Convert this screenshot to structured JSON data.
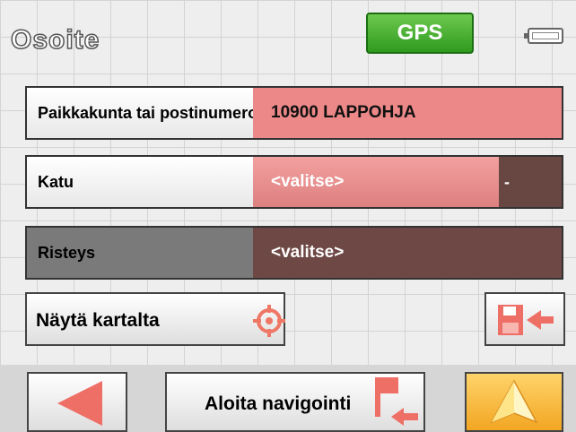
{
  "header": {
    "title": "Osoite",
    "gps_label": "GPS"
  },
  "fields": {
    "city": {
      "label": "Paikkakunta tai postinumero",
      "value": "10900 LAPPOHJA"
    },
    "street": {
      "label": "Katu",
      "value": "<valitse>",
      "side_value": "-"
    },
    "crossing": {
      "label": "Risteys",
      "value": "<valitse>"
    }
  },
  "buttons": {
    "show_on_map": "Näytä kartalta",
    "start_navigation": "Aloita navigointi"
  },
  "icons": {
    "gps": "gps-status-icon",
    "battery": "battery-icon",
    "crosshair": "crosshair-icon",
    "save": "save-flag-icon",
    "back": "back-arrow-icon",
    "flag": "destination-flag-icon",
    "navigate": "navigation-arrow-icon"
  },
  "colors": {
    "accent_red": "#ec8888",
    "dark_brown": "#684642",
    "gps_green": "#2f9a1f",
    "go_orange": "#f2a623"
  }
}
